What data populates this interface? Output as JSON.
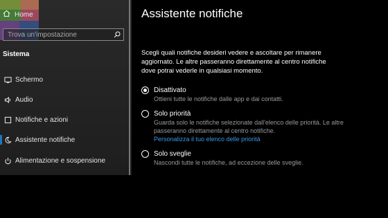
{
  "sidebar": {
    "home_label": "Home",
    "search_placeholder": "Trova un'impostazione",
    "section_title": "Sistema",
    "items": [
      {
        "label": "Schermo",
        "icon": "monitor-icon"
      },
      {
        "label": "Audio",
        "icon": "speaker-icon"
      },
      {
        "label": "Notifiche e azioni",
        "icon": "notification-icon"
      },
      {
        "label": "Assistente notifiche",
        "icon": "moon-icon"
      },
      {
        "label": "Alimentazione e sospensione",
        "icon": "power-icon"
      }
    ]
  },
  "main": {
    "title": "Assistente notifiche",
    "intro": "Scegli quali notifiche desideri vedere e ascoltare per rimanere aggiornato. Le altre passeranno direttamente al centro notifiche dove potrai vederle in qualsiasi momento.",
    "options": [
      {
        "label": "Disattivato",
        "desc": "Ottieni tutte le notifiche dalle app e dai contatti.",
        "selected": true
      },
      {
        "label": "Solo priorità",
        "desc": "Guarda solo le notifiche selezionate dall'elenco delle priorità. Le altre passeranno direttamente al centro notifiche.",
        "link": "Personalizza il tuo elenco delle priorità",
        "selected": false
      },
      {
        "label": "Solo sveglie",
        "desc": "Nascondi tutte le notifiche, ad eccezione delle sveglie.",
        "selected": false
      }
    ]
  },
  "colors": {
    "accent": "#1a78c2",
    "link": "#3f96e0",
    "background": "#000000",
    "sidebar": "#222222"
  }
}
